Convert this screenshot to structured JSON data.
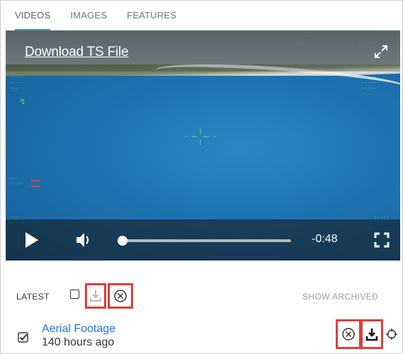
{
  "tabs": [
    {
      "label": "VIDEOS",
      "active": true
    },
    {
      "label": "IMAGES",
      "active": false
    },
    {
      "label": "FEATURES",
      "active": false
    }
  ],
  "video": {
    "download_link": "Download TS File",
    "time_remaining": "-0:48",
    "progress": 0.0
  },
  "list": {
    "latest_label": "LATEST",
    "show_archived_label": "SHOW ARCHIVED",
    "items": [
      {
        "title": "Aerial Footage",
        "age": "140 hours ago",
        "checked": true
      }
    ]
  },
  "colors": {
    "highlight": "#e23b3b",
    "link": "#1a73e8",
    "hud": "#3cff3c"
  },
  "icons": [
    "play-icon",
    "volume-icon",
    "fullscreen-icon",
    "expand-icon",
    "download-icon",
    "cancel-icon",
    "crosshair-icon",
    "checkbox-icon"
  ]
}
